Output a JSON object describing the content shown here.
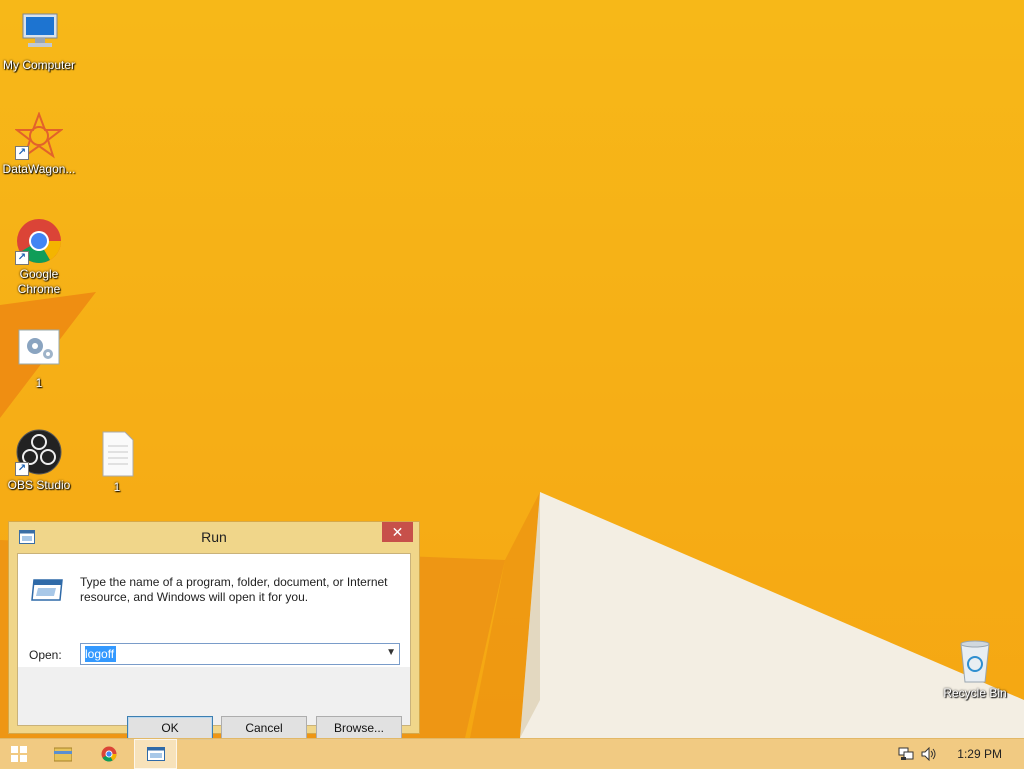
{
  "desktop": {
    "icons": [
      {
        "label": "My Computer",
        "icon": "computer-icon"
      },
      {
        "label": "DataWagon...",
        "icon": "datawagon-icon"
      },
      {
        "label": "Google Chrome",
        "icon": "chrome-icon"
      },
      {
        "label": "1",
        "icon": "settings-file-icon"
      },
      {
        "label": "OBS Studio",
        "icon": "obs-icon"
      },
      {
        "label": "1",
        "icon": "text-file-icon"
      },
      {
        "label": "Recycle Bin",
        "icon": "recycle-bin-icon"
      }
    ]
  },
  "run_dialog": {
    "title": "Run",
    "close": "✕",
    "description": "Type the name of a program, folder, document, or Internet resource, and Windows will open it for you.",
    "open_label": "Open:",
    "open_value": "logoff",
    "ok_label": "OK",
    "cancel_label": "Cancel",
    "browse_label": "Browse..."
  },
  "taskbar": {
    "buttons": [
      "start-icon",
      "file-explorer-icon",
      "chrome-icon",
      "run-icon"
    ],
    "active": "run-icon",
    "clock": "1:29 PM"
  },
  "colors": {
    "wallpaper": "#f6ae16",
    "close_button": "#c7504a",
    "selection": "#3399ff"
  }
}
